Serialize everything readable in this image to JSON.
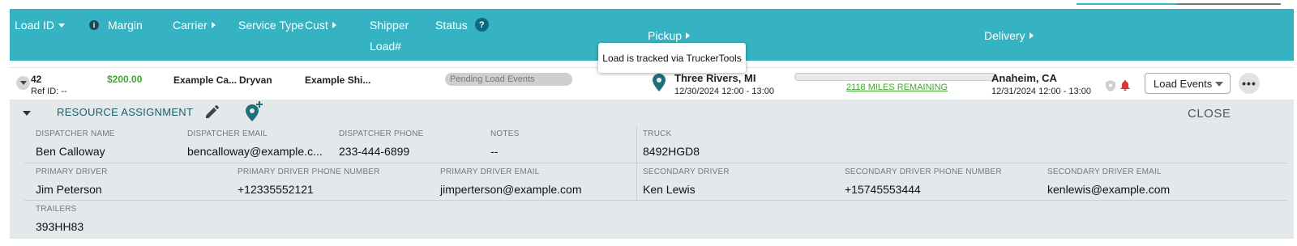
{
  "header": {
    "columns": {
      "load_id": "Load ID",
      "margin": "Margin",
      "carrier": "Carrier",
      "service_type": "Service Type",
      "cust": "Cust",
      "shipper": "Shipper",
      "load_num": "Load#",
      "status": "Status",
      "pickup": "Pickup",
      "delivery": "Delivery"
    },
    "info_icon": "i",
    "help_icon": "?"
  },
  "tooltip": {
    "text": "Load is tracked via TruckerTools"
  },
  "row": {
    "load_id": "42",
    "ref_id": "Ref ID: --",
    "margin": "$200.00",
    "carrier": "Example Ca...",
    "service_type": "Dryvan",
    "cust": "Example Shi...",
    "status": "Pending Load Events",
    "pickup": {
      "city": "Three Rivers, MI",
      "window": "12/30/2024 12:00 - 13:00"
    },
    "miles_remaining": "2118 MILES REMAINING",
    "progress": 0,
    "delivery": {
      "city": "Anaheim, CA",
      "window": "12/31/2024 12:00 - 13:00"
    },
    "load_events_label": "Load Events",
    "more_label": "•••"
  },
  "resource_assignment": {
    "title": "RESOURCE ASSIGNMENT",
    "close_label": "CLOSE",
    "dispatcher_name": {
      "label": "DISPATCHER NAME",
      "value": "Ben Calloway"
    },
    "dispatcher_email": {
      "label": "DISPATCHER EMAIL",
      "value": "bencalloway@example.c..."
    },
    "dispatcher_phone": {
      "label": "DISPATCHER PHONE",
      "value": "233-444-6899"
    },
    "notes": {
      "label": "NOTES",
      "value": "--"
    },
    "truck": {
      "label": "TRUCK",
      "value": "8492HGD8"
    },
    "primary_driver": {
      "label": "PRIMARY DRIVER",
      "value": "Jim Peterson"
    },
    "primary_driver_phone": {
      "label": "PRIMARY DRIVER PHONE NUMBER",
      "value": "+12335552121"
    },
    "primary_driver_email": {
      "label": "PRIMARY DRIVER EMAIL",
      "value": "jimperterson@example.com"
    },
    "secondary_driver": {
      "label": "SECONDARY DRIVER",
      "value": "Ken Lewis"
    },
    "secondary_driver_phone": {
      "label": "SECONDARY DRIVER PHONE NUMBER",
      "value": "+15745553444"
    },
    "secondary_driver_email": {
      "label": "SECONDARY DRIVER EMAIL",
      "value": "kenlewis@example.com"
    },
    "trailers": {
      "label": "TRAILERS",
      "value": "393HH83"
    }
  },
  "colors": {
    "header_bg": "#36b3c3",
    "margin_green": "#3fa82c",
    "accent_teal": "#1e5e6a",
    "alert_red": "#e0322e"
  }
}
